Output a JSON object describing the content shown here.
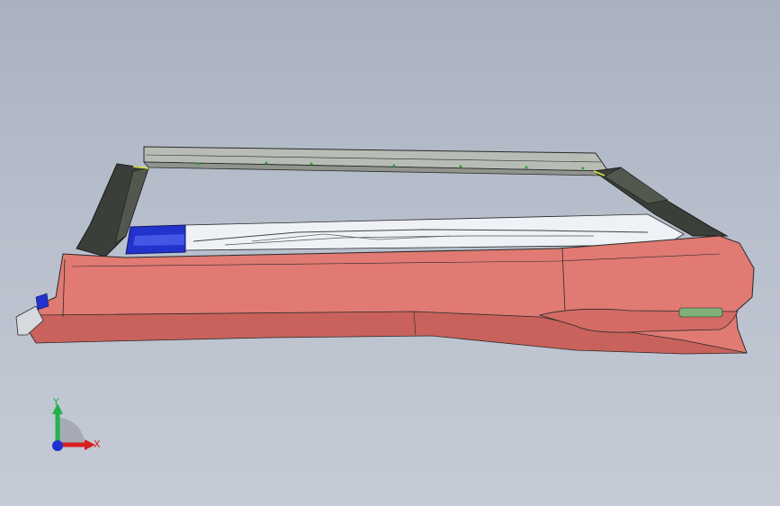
{
  "viewport": {
    "background_top": "#a9b1bf",
    "background_bottom": "#c5cbd6"
  },
  "model": {
    "description_icon": "cad-assembly-icon",
    "colors": {
      "body": "#e07a72",
      "body_shadow": "#c9625c",
      "frame_dark": "#3b3f3a",
      "frame_light": "#b7bcb4",
      "slider_blue": "#2233cc",
      "rail_white": "#eef1f6",
      "edge": "#2a2a2a"
    }
  },
  "triad": {
    "x_label": "X",
    "y_label": "Y",
    "x_color": "#d62020",
    "y_color": "#22b14c",
    "z_color": "#2030d0"
  }
}
